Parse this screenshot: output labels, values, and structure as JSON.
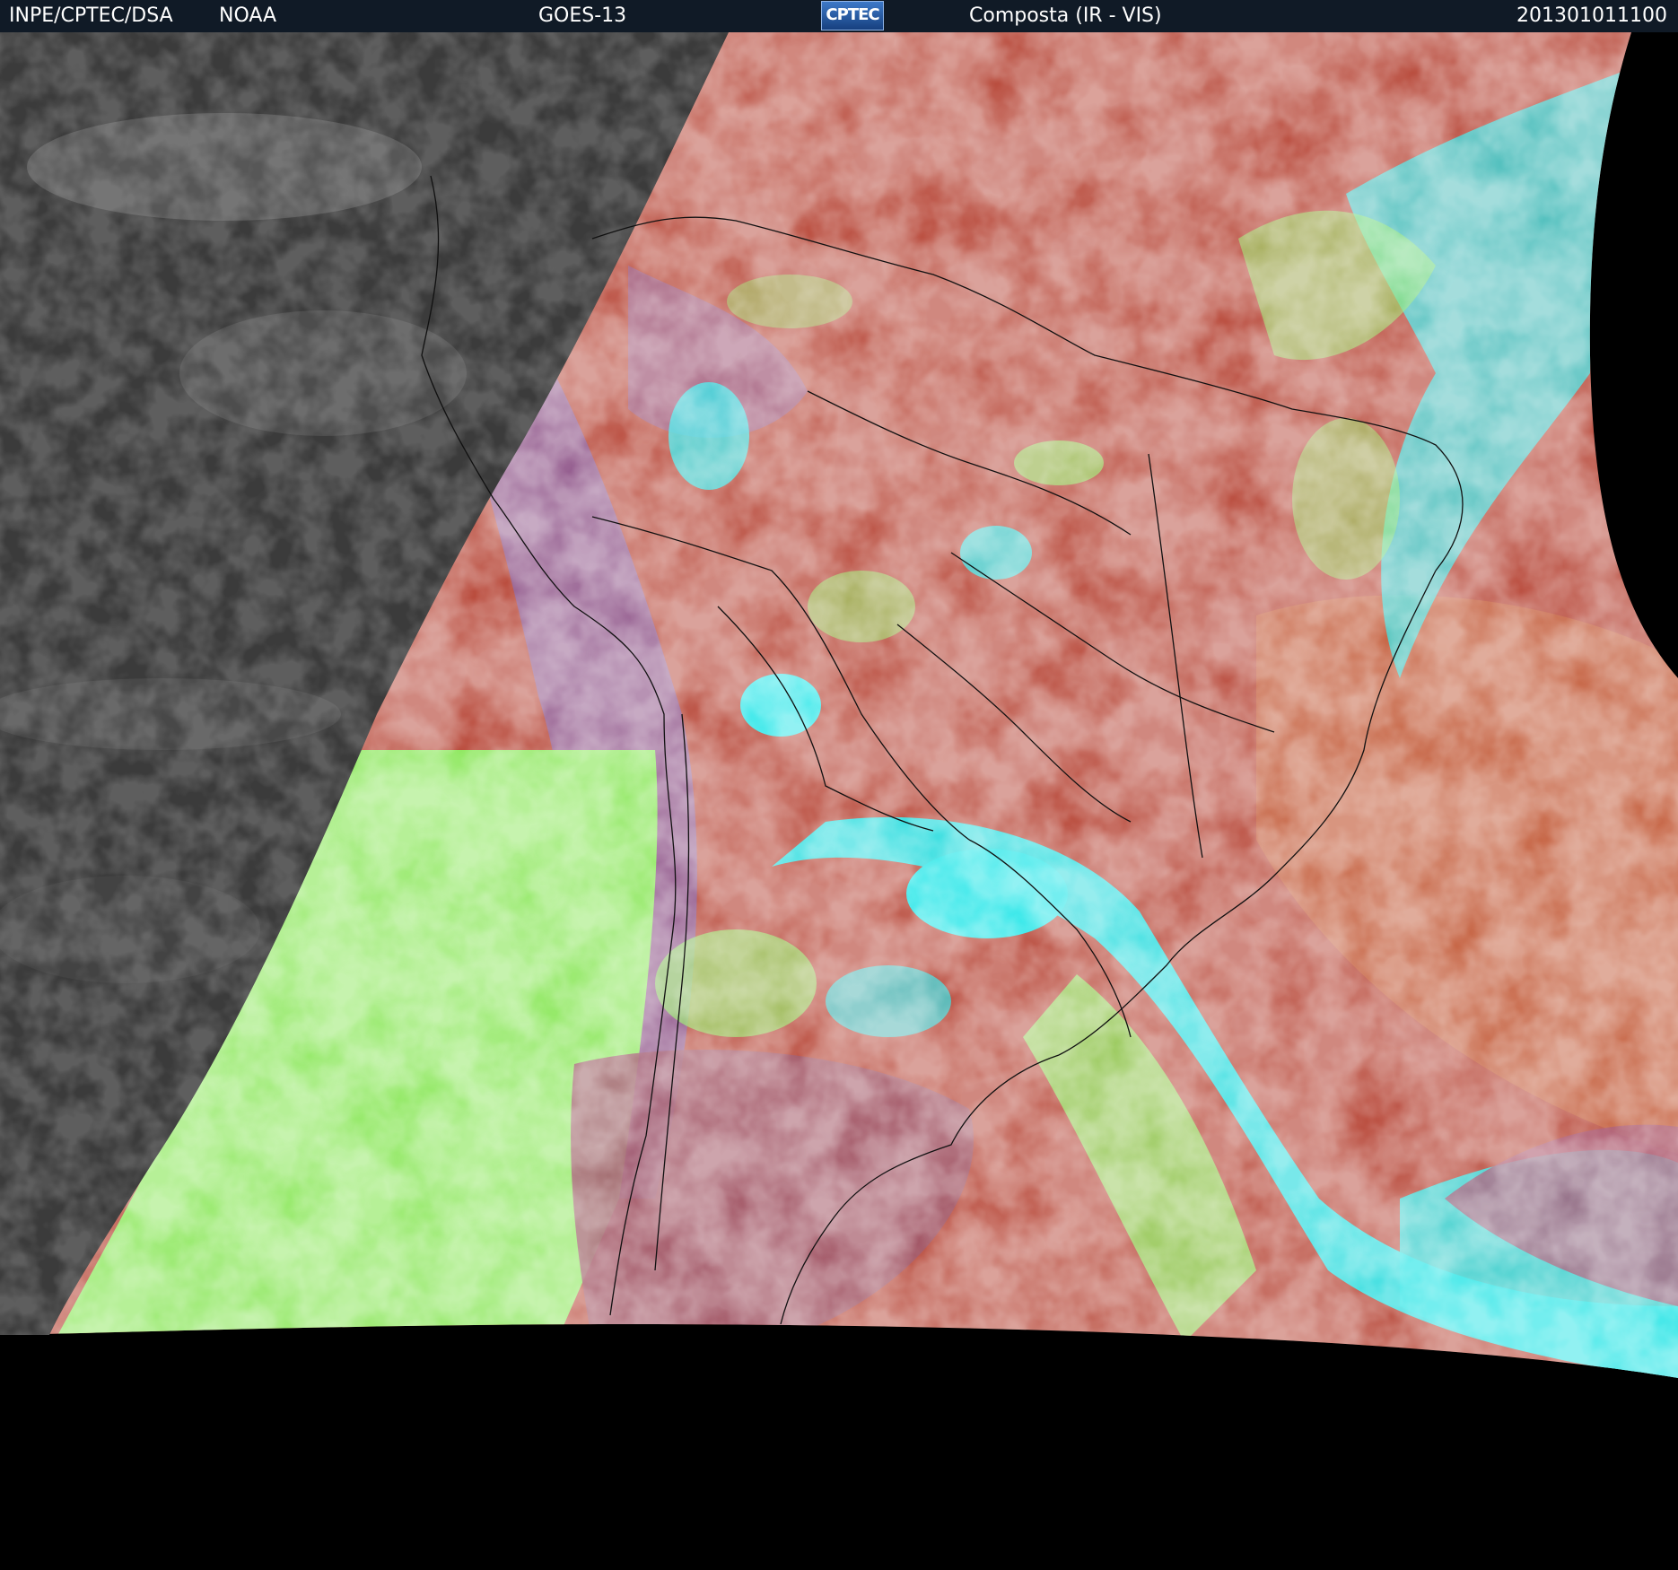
{
  "header": {
    "agency": "INPE/CPTEC/DSA",
    "source": "NOAA",
    "satellite": "GOES-13",
    "logo": "CPTEC",
    "product": "Composta (IR - VIS)",
    "timestamp": "201301011100"
  },
  "colors": {
    "header_bg": "#101a26",
    "space": "#000000",
    "night_ir": "#3b3b3b",
    "land_warm": "#b8493a",
    "cloud_low_green": "#8fe860",
    "cloud_high_cyan": "#28e6e8",
    "cloud_purple": "#8a5a9a",
    "border_line": "#111111"
  }
}
